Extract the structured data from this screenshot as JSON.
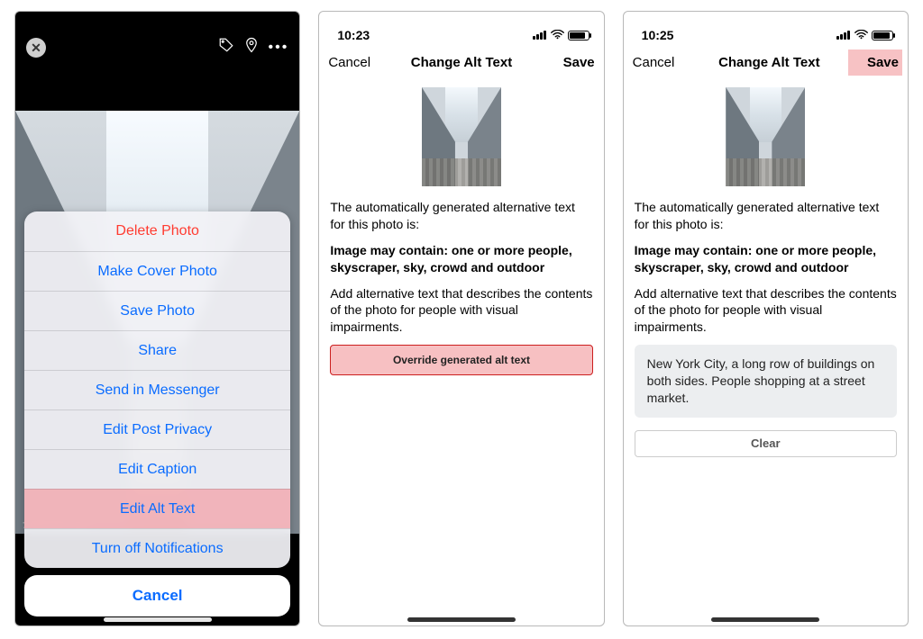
{
  "phone1": {
    "timestamp_overlay": "7 MINUTES AGO",
    "sheet_items": [
      {
        "label": "Delete Photo",
        "destructive": true,
        "highlight": false
      },
      {
        "label": "Make Cover Photo",
        "destructive": false,
        "highlight": false
      },
      {
        "label": "Save Photo",
        "destructive": false,
        "highlight": false
      },
      {
        "label": "Share",
        "destructive": false,
        "highlight": false
      },
      {
        "label": "Send in Messenger",
        "destructive": false,
        "highlight": false
      },
      {
        "label": "Edit Post Privacy",
        "destructive": false,
        "highlight": false
      },
      {
        "label": "Edit Caption",
        "destructive": false,
        "highlight": false
      },
      {
        "label": "Edit Alt Text",
        "destructive": false,
        "highlight": true
      },
      {
        "label": "Turn off Notifications",
        "destructive": false,
        "highlight": false
      }
    ],
    "cancel_label": "Cancel"
  },
  "phone2": {
    "status_time": "10:23",
    "nav": {
      "cancel": "Cancel",
      "title": "Change Alt Text",
      "save": "Save",
      "save_highlight": false
    },
    "intro": "The automatically generated alternative text for this photo is:",
    "generated": "Image may contain: one or more people, skyscraper, sky, crowd and outdoor",
    "instruction": "Add alternative text that describes the contents of the photo for people with visual impairments.",
    "override_label": "Override generated alt text"
  },
  "phone3": {
    "status_time": "10:25",
    "nav": {
      "cancel": "Cancel",
      "title": "Change Alt Text",
      "save": "Save",
      "save_highlight": true
    },
    "intro": "The automatically generated alternative text for this photo is:",
    "generated": "Image may contain: one or more people, skyscraper, sky, crowd and outdoor",
    "instruction": "Add alternative text that describes the contents of the photo for people with visual impairments.",
    "alt_text_value": "New York City, a long row of buildings on both sides. People shopping at a street market.",
    "clear_label": "Clear"
  }
}
